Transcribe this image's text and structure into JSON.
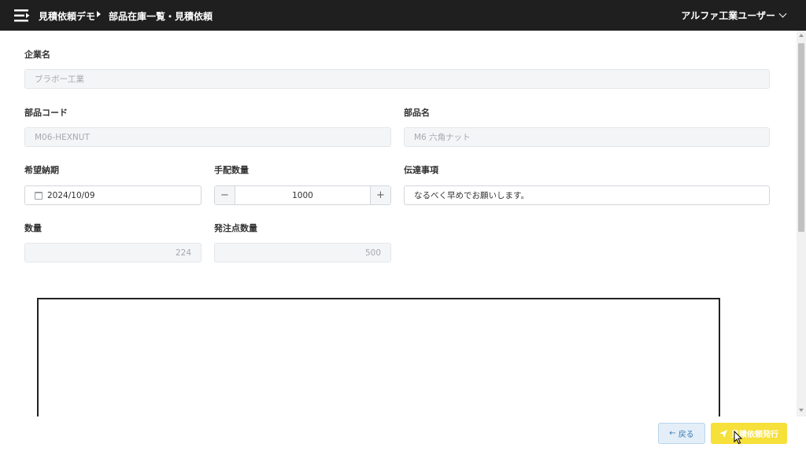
{
  "header": {
    "app_name": "見積依頼デモ",
    "page_title": "部品在庫一覧・見積依頼",
    "user_name": "アルファ工業ユーザー"
  },
  "form": {
    "company": {
      "label": "企業名",
      "value": "ブラボー工業"
    },
    "part_code": {
      "label": "部品コード",
      "value": "M06-HEXNUT"
    },
    "part_name": {
      "label": "部品名",
      "value": "M6 六角ナット"
    },
    "delivery_date": {
      "label": "希望納期",
      "value": "2024/10/09"
    },
    "order_qty": {
      "label": "手配数量",
      "value": "1000",
      "minus": "−",
      "plus": "+"
    },
    "message": {
      "label": "伝達事項",
      "value": "なるべく早めでお願いします。"
    },
    "quantity": {
      "label": "数量",
      "value": "224"
    },
    "reorder_point": {
      "label": "発注点数量",
      "value": "500"
    }
  },
  "footer": {
    "back_label": "戻る",
    "back_icon": "arrow-left-icon",
    "issue_label": "見積依頼発行",
    "issue_icon": "send-icon"
  },
  "colors": {
    "header_bg": "#1f1f1f",
    "issue_button": "#f6e03a",
    "back_button": "#e3eef8"
  }
}
